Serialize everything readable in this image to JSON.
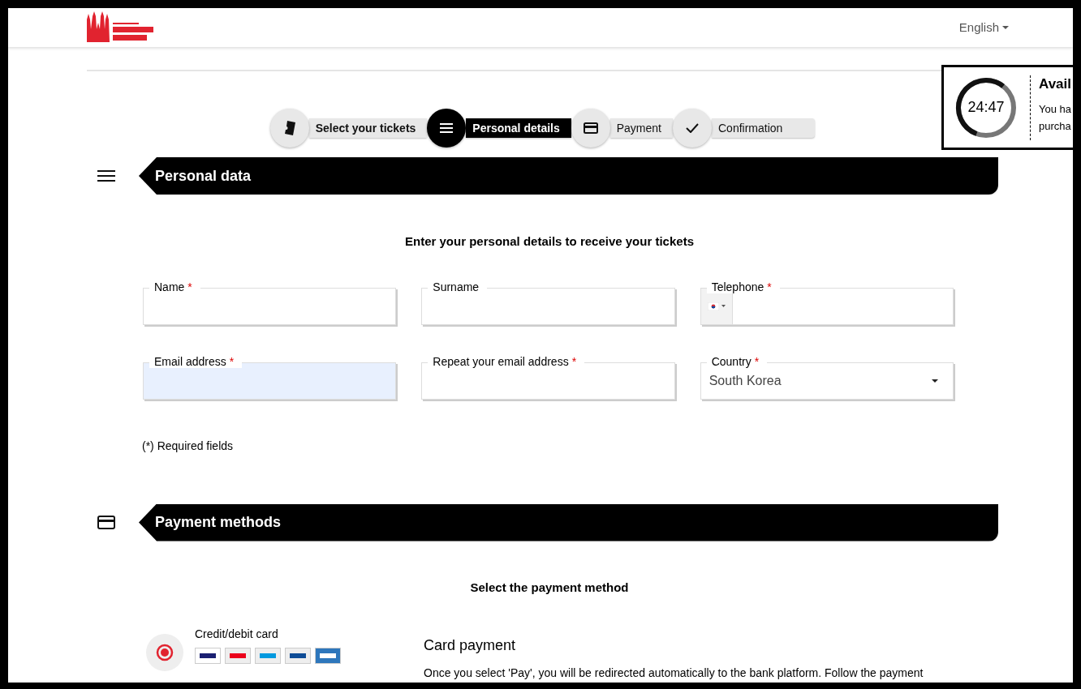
{
  "header": {
    "language": "English"
  },
  "timer": {
    "time": "24:47",
    "level": 0.55,
    "title": "Avail",
    "message_lines": [
      "You ha",
      "purcha"
    ]
  },
  "steps": [
    {
      "label": "Select your tickets",
      "selected": false,
      "done": true
    },
    {
      "label": "Personal details",
      "selected": true,
      "done": false
    },
    {
      "label": "Payment",
      "selected": false,
      "done": false
    },
    {
      "label": "Confirmation",
      "selected": false,
      "done": false
    }
  ],
  "personal_data": {
    "title": "Personal data",
    "intro": "Enter your personal details to receive your tickets",
    "fields": [
      {
        "label": "Name",
        "required_mark": "*",
        "kind": "text",
        "autofilled": false
      },
      {
        "label": "Surname",
        "kind": "text",
        "autofilled": false
      },
      {
        "label": "Telephone",
        "required_mark": "*",
        "kind": "phone",
        "autofilled": false
      },
      {
        "label": "Email address",
        "required_mark": "*",
        "kind": "text",
        "autofilled": true
      },
      {
        "label": "Repeat your email address",
        "required_mark": "*",
        "kind": "text",
        "autofilled": false
      },
      {
        "label": "Country",
        "required_mark": "*",
        "kind": "select",
        "value": "South Korea",
        "autofilled": false
      }
    ],
    "note": "(*) Required fields"
  },
  "payment": {
    "title": "Payment methods",
    "intro": "Select the payment method",
    "methods": [
      {
        "label": "Credit/debit card",
        "selected": true
      }
    ],
    "detail_title": "Card payment",
    "detail_text": "Once you select 'Pay', you will be redirected automatically to the bank platform. Follow the payment"
  }
}
